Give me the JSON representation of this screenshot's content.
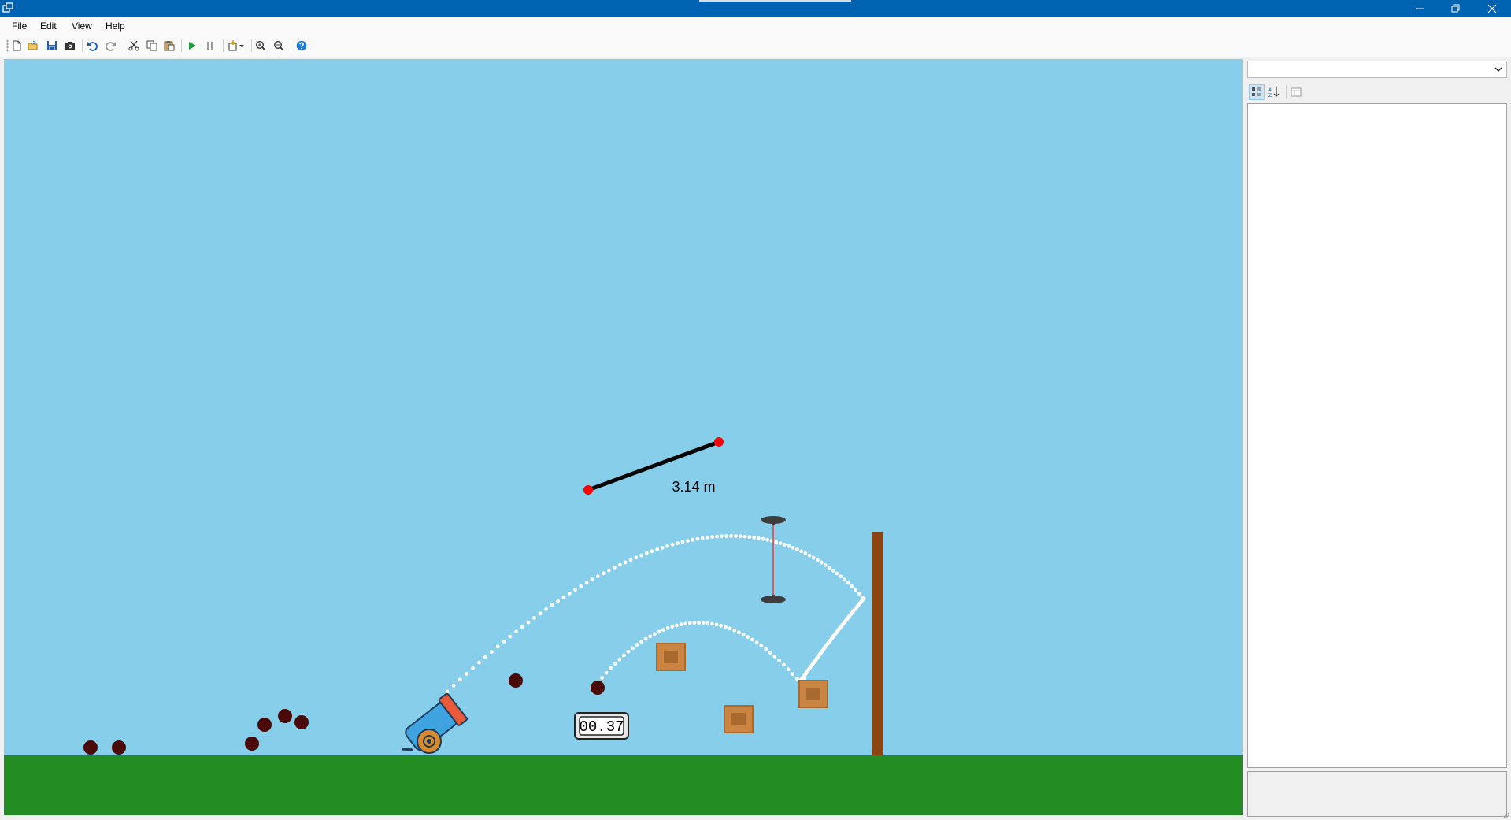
{
  "window": {
    "controls": [
      "minimize",
      "restore",
      "close"
    ]
  },
  "menu": [
    "File",
    "Edit",
    "View",
    "Help"
  ],
  "toolbar": {
    "buttons": [
      "new-icon",
      "open-icon",
      "save-icon",
      "camera-icon",
      "undo-icon",
      "redo-icon",
      "cut-icon",
      "copy-icon",
      "paste-icon",
      "play-icon",
      "pause-icon",
      "add-object-icon",
      "zoom-in-icon",
      "zoom-out-icon",
      "help-icon"
    ]
  },
  "scene": {
    "colors": {
      "sky": "#87ceeb",
      "ground": "#228b22",
      "cannon_barrel": "#3fa3df",
      "cannon_wheel": "#d98a2f",
      "ball": "#4a0a0a",
      "crate": "#c98541",
      "post": "#8b4513",
      "ruler_end": "#ff0000"
    },
    "measure": {
      "label": "3.14 m"
    },
    "timer": {
      "value": "00.37"
    }
  },
  "properties_panel": {
    "object_selector": {
      "value": ""
    },
    "view_buttons": [
      "categorized-icon",
      "alphabetical-icon",
      "property-pages-icon"
    ]
  }
}
